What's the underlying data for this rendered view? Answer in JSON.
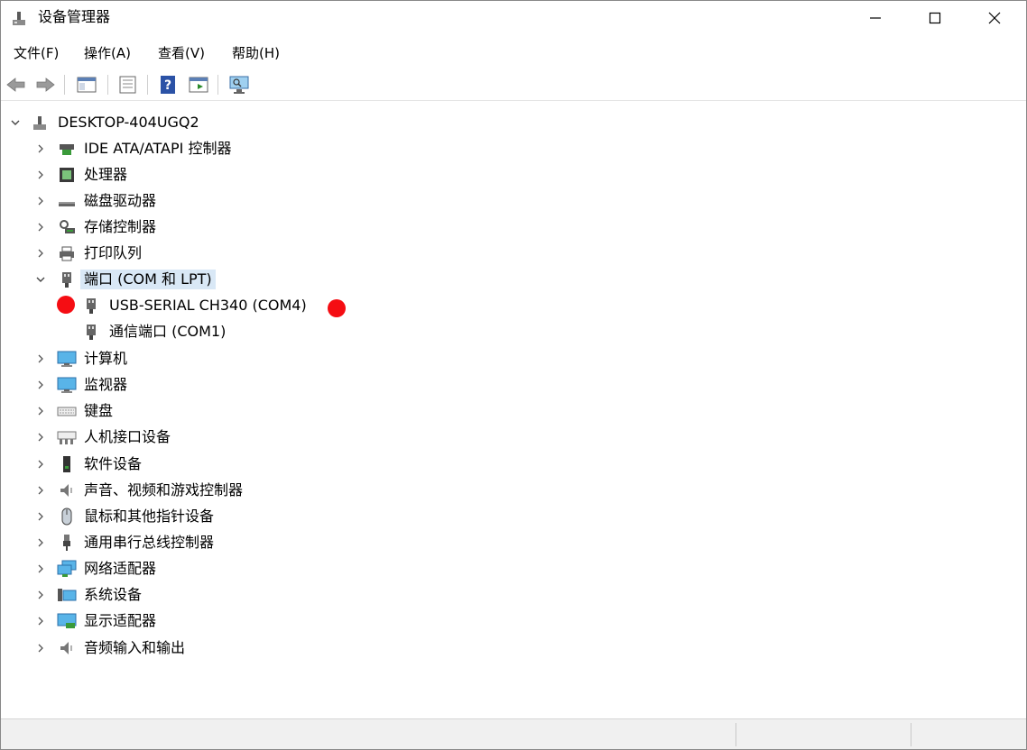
{
  "window": {
    "title": "设备管理器"
  },
  "menu": [
    {
      "label": "文件(F)"
    },
    {
      "label": "操作(A)"
    },
    {
      "label": "查看(V)"
    },
    {
      "label": "帮助(H)"
    }
  ],
  "toolbar": {
    "icons": [
      "back-arrow-icon",
      "forward-arrow-icon",
      "properties-pane-icon",
      "properties-sheet-icon",
      "help-icon",
      "run-icon",
      "monitor-scan-icon"
    ]
  },
  "tree": {
    "root": "DESKTOP-404UGQ2",
    "categories": {
      "ide": "IDE ATA/ATAPI 控制器",
      "cpu": "处理器",
      "disk": "磁盘驱动器",
      "storage": "存储控制器",
      "print": "打印队列",
      "ports": "端口 (COM 和 LPT)",
      "port1": "USB-SERIAL CH340 (COM4)",
      "port2": "通信端口 (COM1)",
      "computer": "计算机",
      "monitor": "监视器",
      "keyboard": "键盘",
      "hid": "人机接口设备",
      "software": "软件设备",
      "sound": "声音、视频和游戏控制器",
      "mouse": "鼠标和其他指针设备",
      "usb": "通用串行总线控制器",
      "network": "网络适配器",
      "system": "系统设备",
      "display": "显示适配器",
      "audio": "音频输入和输出"
    }
  },
  "colors": {
    "marker": "#f50d13",
    "selection": "#d9e8f6"
  }
}
